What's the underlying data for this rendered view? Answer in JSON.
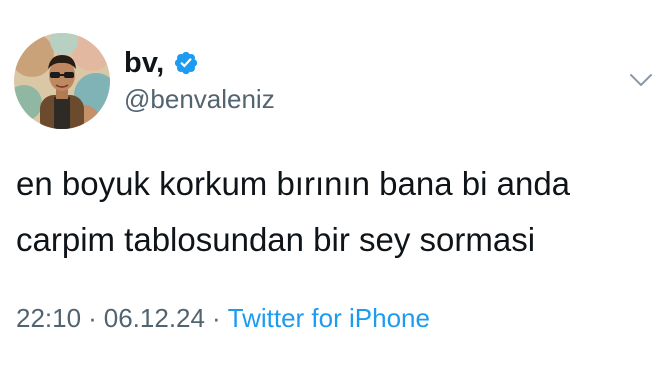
{
  "author": {
    "display_name": "bv,",
    "handle": "@benvaleniz",
    "verified": true,
    "avatar_icon": "profile-photo"
  },
  "tweet": {
    "lines": [
      "en boyuk korkum bırının bana bi anda",
      "carpim tablosundan bir sey sormasi"
    ]
  },
  "meta": {
    "time": "22:10",
    "date": "06.12.24",
    "separator": "·",
    "source": "Twitter for iPhone"
  },
  "icons": {
    "verified": "verified-badge-icon",
    "menu": "chevron-down-icon"
  },
  "colors": {
    "text": "#0f1419",
    "secondary": "#536471",
    "accent": "#1d9bf0",
    "background": "#ffffff"
  }
}
